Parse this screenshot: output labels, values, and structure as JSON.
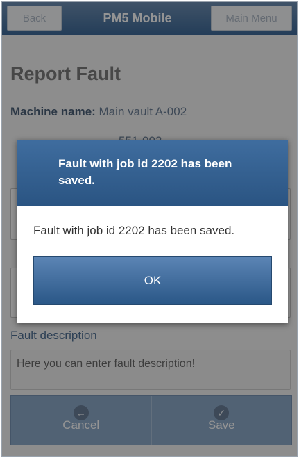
{
  "header": {
    "back_label": "Back",
    "title": "PM5 Mobile",
    "menu_label": "Main Menu"
  },
  "page": {
    "title": "Report Fault",
    "machine_name_key": "Machine name:",
    "machine_name_value": "Main vault A-002",
    "machine_number_partial": "551-002",
    "fault_description_label": "Fault description",
    "fault_description_placeholder": "Here you can enter fault description!"
  },
  "bottom_bar": {
    "cancel_label": "Cancel",
    "cancel_icon": "back-arrow-icon",
    "save_label": "Save",
    "save_icon": "checkmark-icon"
  },
  "dialog": {
    "title": "Fault with job id 2202 has been saved.",
    "message": "Fault with job id 2202 has been saved.",
    "ok_label": "OK"
  },
  "colors": {
    "header_top": "#6e8fb3",
    "header_bottom": "#3f6a99",
    "dialog_header": "#2f5b8b",
    "bottom_bar": "#8ca9c9"
  }
}
